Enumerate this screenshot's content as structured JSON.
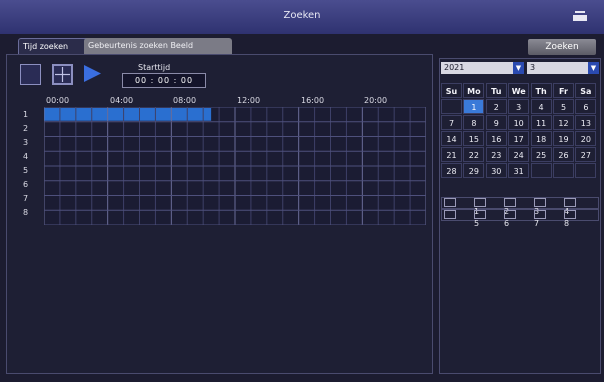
{
  "window": {
    "title": "Zoeken"
  },
  "tabs": [
    {
      "label": "Tijd zoeken",
      "active": true
    },
    {
      "label": "Gebeurtenis zoeken Beeld",
      "active": false
    }
  ],
  "search_button": "Zoeken",
  "playback": {
    "controls": [
      "single-view-icon",
      "quad-view-icon",
      "play-icon"
    ],
    "start_time_label": "Starttijd",
    "start_time": "00 : 00 : 00"
  },
  "timeline": {
    "hour_labels": [
      "00:00",
      "04:00",
      "08:00",
      "12:00",
      "16:00",
      "20:00"
    ],
    "channels": [
      "1",
      "2",
      "3",
      "4",
      "5",
      "6",
      "7",
      "8"
    ],
    "recording": [
      {
        "channel": "1",
        "start_hour": 0,
        "end_hour": 10.5
      }
    ]
  },
  "calendar": {
    "year": "2021",
    "month": "3",
    "weekdays": [
      "Su",
      "Mo",
      "Tu",
      "We",
      "Th",
      "Fr",
      "Sa"
    ],
    "weeks": [
      [
        "",
        "1",
        "2",
        "3",
        "4",
        "5",
        "6"
      ],
      [
        "7",
        "8",
        "9",
        "10",
        "11",
        "12",
        "13"
      ],
      [
        "14",
        "15",
        "16",
        "17",
        "18",
        "19",
        "20"
      ],
      [
        "21",
        "22",
        "23",
        "24",
        "25",
        "26",
        "27"
      ],
      [
        "28",
        "29",
        "30",
        "31",
        "",
        "",
        ""
      ]
    ],
    "selected_day": "1"
  },
  "channel_select": {
    "items": [
      {
        "label": "",
        "kind": "all"
      },
      {
        "label": "1"
      },
      {
        "label": "2"
      },
      {
        "label": "3"
      },
      {
        "label": "4"
      },
      {
        "label": "",
        "kind": "all"
      },
      {
        "label": "5"
      },
      {
        "label": "6"
      },
      {
        "label": "7"
      },
      {
        "label": "8"
      }
    ]
  },
  "colors": {
    "accent": "#3a7ad8",
    "titlebar": "#3c3f80",
    "background": "#1c1c30",
    "recording": "#2a6fd0"
  }
}
